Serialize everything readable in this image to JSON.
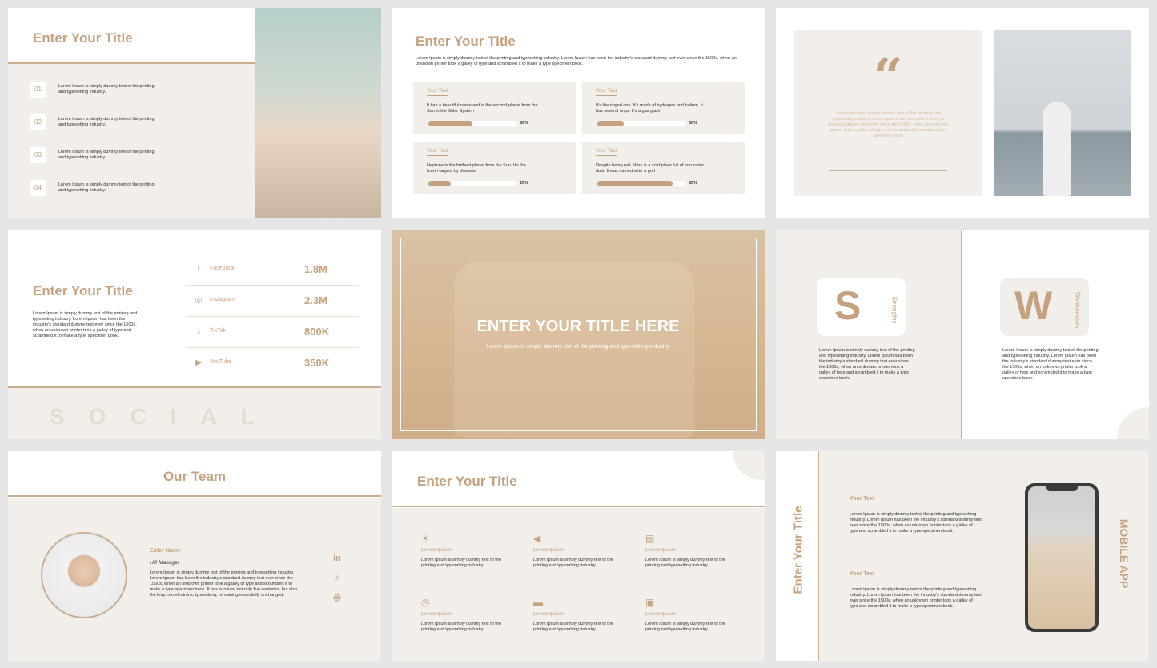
{
  "colors": {
    "accent": "#c4a27f",
    "beige": "#f2eee9",
    "text": "#333333"
  },
  "slide1": {
    "title": "Enter Your Title",
    "steps": [
      {
        "num": "01",
        "text": "Lorem Ipsum is simply dummy text of the printing and typesetting industry."
      },
      {
        "num": "02",
        "text": "Lorem Ipsum is simply dummy text of the printing and typesetting industry."
      },
      {
        "num": "03",
        "text": "Lorem Ipsum is simply dummy text of the printing and typesetting industry."
      },
      {
        "num": "04",
        "text": "Lorem Ipsum is simply dummy text of the printing and typesetting industry."
      }
    ]
  },
  "slide2": {
    "title": "Enter Your Title",
    "intro": "Lorem Ipsum is simply dummy text of the printing and typesetting industry. Lorem Ipsum has been the industry's standard dummy text ever since the 1500s, when an unknown printer took a galley of type and scrambled it to make a type specimen book.",
    "cards": [
      {
        "label": "Your Text",
        "text": "It has a beautiful name and is the second planet from the Sun in the Solar System",
        "percent": 50,
        "percent_label": "50%"
      },
      {
        "label": "Your Text",
        "text": "It's the ringed one. It's made of hydrogen and helium. It has several rings. It's a gas giant",
        "percent": 30,
        "percent_label": "30%"
      },
      {
        "label": "Your Text",
        "text": "Neptune is the farthest planet from the Sun. It's the fourth-largest by diameter",
        "percent": 25,
        "percent_label": "25%"
      },
      {
        "label": "Your Text",
        "text": "Despite being red, Mars is a cold place full of iron oxide dust. It was named after a god",
        "percent": 85,
        "percent_label": "85%"
      }
    ]
  },
  "slide3": {
    "quote_mark": "“",
    "quote": "Lorem Ipsum is simply dummy text of the printing and typesetting industry. Lorem Ipsum has been the industry's standard dummy text ever since the 1500s, when an unknown printer took a galley of type and scrambled it to make a type specimen book."
  },
  "slide4": {
    "title": "Enter Your Title",
    "desc": "Lorem Ipsum is simply dummy text of the printing and typesetting industry. Lorem Ipsum has been the industry's standard dummy text ever since the 1500s, when an unknown printer took a galley of type and scrambled it to make a type specimen book.",
    "watermark": "SOCIAL",
    "rows": [
      {
        "icon": "f",
        "name": "Facebook",
        "value": "1.8M"
      },
      {
        "icon": "◎",
        "name": "Instagram",
        "value": "2.3M"
      },
      {
        "icon": "♪",
        "name": "TikTok",
        "value": "800K"
      },
      {
        "icon": "▶",
        "name": "YouTube",
        "value": "350K"
      }
    ]
  },
  "slide5": {
    "title": "ENTER YOUR TITLE HERE",
    "subtitle": "Lorem Ipsum is simply dummy text of the printing and typesetting industry."
  },
  "slide6": {
    "s": {
      "letter": "S",
      "label": "Strengths",
      "text": "Lorem Ipsum is simply dummy text of the printing and typesetting industry. Lorem Ipsum has been the industry's standard dummy text ever since the 1500s, when an unknown printer took a galley of type and scrambled it to make a type specimen book."
    },
    "w": {
      "letter": "W",
      "label": "Weaknesses",
      "text": "Lorem Ipsum is simply dummy text of the printing and typesetting industry. Lorem Ipsum has been the industry's standard dummy text ever since the 1500s, when an unknown printer took a galley of type and scrambled it to make a type specimen book."
    }
  },
  "slide7": {
    "title": "Our Team",
    "name": "Enter Name",
    "role": "HR Manager",
    "bio": "Lorem Ipsum is simply dummy text of the printing and typesetting industry. Lorem Ipsum has been the industry's standard dummy text ever since the 1500s, when an unknown printer took a galley of type and scrambled it to make a type specimen book. It has survived not only five centuries, but also the leap into electronic typesetting, remaining essentially unchanged.",
    "socials": [
      "in",
      "♪",
      "◎"
    ]
  },
  "slide8": {
    "title": "Enter Your Title",
    "features": [
      {
        "icon": "☀",
        "label": "Lorem Ipsum",
        "text": "Lorem Ipsum is simply dummy text of the printing and typesetting industry."
      },
      {
        "icon": "◀",
        "label": "Lorem Ipsum",
        "text": "Lorem Ipsum is simply dummy text of the printing and typesetting industry."
      },
      {
        "icon": "▤",
        "label": "Lorem Ipsum",
        "text": "Lorem Ipsum is simply dummy text of the printing and typesetting industry."
      },
      {
        "icon": "◷",
        "label": "Lorem Ipsum",
        "text": "Lorem Ipsum is simply dummy text of the printing and typesetting industry."
      },
      {
        "icon": "▬",
        "label": "Lorem Ipsum",
        "text": "Lorem Ipsum is simply dummy text of the printing and typesetting industry."
      },
      {
        "icon": "▣",
        "label": "Lorem Ipsum",
        "text": "Lorem Ipsum is simply dummy text of the printing and typesetting industry."
      }
    ]
  },
  "slide9": {
    "vertical_title": "Enter Your Title",
    "side_label": "MOBILE APP",
    "items": [
      {
        "title": "Your Text",
        "text": "Lorem Ipsum is simply dummy text of the printing and typesetting industry. Lorem Ipsum has been the industry's standard dummy text ever since the 1500s, when an unknown printer took a galley of type and scrambled it to make a type specimen book."
      },
      {
        "title": "Your Text",
        "text": "Lorem Ipsum is simply dummy text of the printing and typesetting industry. Lorem Ipsum has been the industry's standard dummy text ever since the 1500s, when an unknown printer took a galley of type and scrambled it to make a type specimen book."
      }
    ]
  }
}
